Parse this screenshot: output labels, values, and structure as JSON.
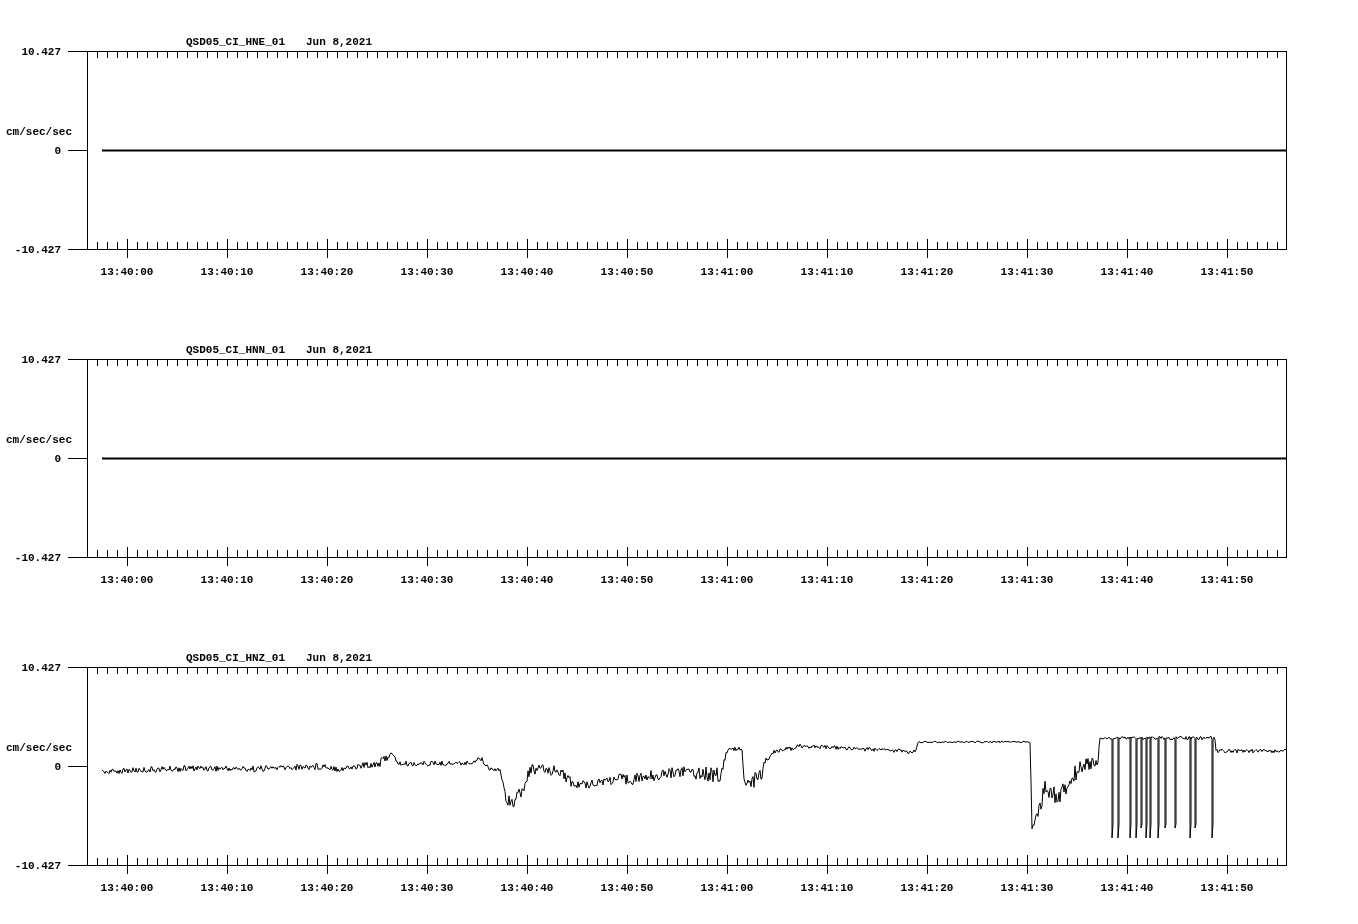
{
  "panels": [
    {
      "station": "QSD05_CI_HNE_01",
      "date": "Jun 8,2021",
      "unit": "cm/sec/sec",
      "y_labels": [
        "10.427",
        "0",
        "-10.427"
      ],
      "x_labels": [
        "13:40:00",
        "13:40:10",
        "13:40:20",
        "13:40:30",
        "13:40:40",
        "13:40:50",
        "13:41:00",
        "13:41:10",
        "13:41:20",
        "13:41:30",
        "13:41:40",
        "13:41:50"
      ]
    },
    {
      "station": "QSD05_CI_HNN_01",
      "date": "Jun 8,2021",
      "unit": "cm/sec/sec",
      "y_labels": [
        "10.427",
        "0",
        "-10.427"
      ],
      "x_labels": [
        "13:40:00",
        "13:40:10",
        "13:40:20",
        "13:40:30",
        "13:40:40",
        "13:40:50",
        "13:41:00",
        "13:41:10",
        "13:41:20",
        "13:41:30",
        "13:41:40",
        "13:41:50"
      ]
    },
    {
      "station": "QSD05_CI_HNZ_01",
      "date": "Jun 8,2021",
      "unit": "cm/sec/sec",
      "y_labels": [
        "10.427",
        "0",
        "-10.427"
      ],
      "x_labels": [
        "13:40:00",
        "13:40:10",
        "13:40:20",
        "13:40:30",
        "13:40:40",
        "13:40:50",
        "13:41:00",
        "13:41:10",
        "13:41:20",
        "13:41:30",
        "13:41:40",
        "13:41:50"
      ],
      "kind": "waveform"
    }
  ]
}
